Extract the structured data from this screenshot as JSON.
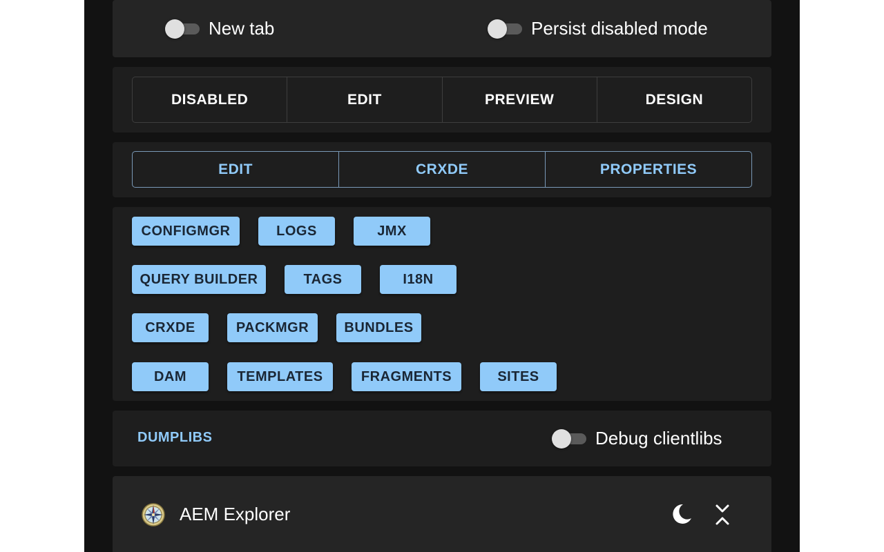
{
  "toggles": {
    "new_tab": "New tab",
    "persist_disabled": "Persist disabled mode",
    "debug_clientlibs": "Debug clientlibs"
  },
  "modes": [
    "DISABLED",
    "EDIT",
    "PREVIEW",
    "DESIGN"
  ],
  "links": [
    "EDIT",
    "CRXDE",
    "PROPERTIES"
  ],
  "tools": {
    "row1": [
      "CONFIGMGR",
      "LOGS",
      "JMX"
    ],
    "row2": [
      "QUERY BUILDER",
      "TAGS",
      "I18N"
    ],
    "row3": [
      "CRXDE",
      "PACKMGR",
      "BUNDLES"
    ],
    "row4": [
      "DAM",
      "TEMPLATES",
      "FRAGMENTS",
      "SITES"
    ]
  },
  "dumplibs_label": "DUMPLIBS",
  "app": {
    "title": "AEM Explorer",
    "logo_icon": "compass-icon",
    "theme_icon": "moon-icon",
    "collapse_icon": "collapse-icon"
  },
  "colors": {
    "accent": "#90caf9",
    "surface": "#1e1e1e",
    "background": "#121212"
  }
}
